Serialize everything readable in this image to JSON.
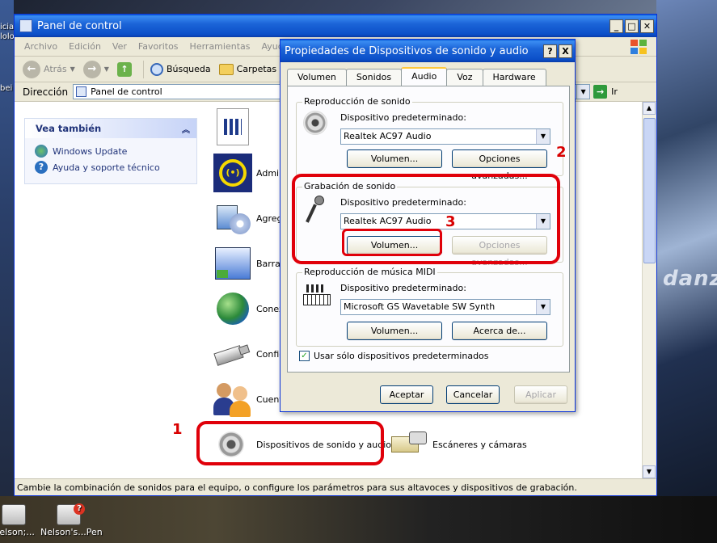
{
  "desktop": {
    "icons": [
      {
        "label": "Nelson;..."
      },
      {
        "label": "Nelson's...Pen"
      }
    ],
    "left_labels": [
      "icia",
      "lolo",
      "bei"
    ],
    "right_text": "danza"
  },
  "explorer": {
    "title": "Panel de control",
    "menu": [
      "Archivo",
      "Edición",
      "Ver",
      "Favoritos",
      "Herramientas",
      "Ayuda"
    ],
    "toolbar": {
      "back": "Atrás",
      "search": "Búsqueda",
      "folders": "Carpetas"
    },
    "address": {
      "label": "Dirección",
      "value": "Panel de control",
      "go": "Ir"
    },
    "see_also": {
      "title": "Vea también",
      "items": [
        "Windows Update",
        "Ayuda y soporte técnico"
      ]
    },
    "items": [
      {
        "label": "Admin"
      },
      {
        "label": "Agreg"
      },
      {
        "label": "Barra"
      },
      {
        "label": "Conex"
      },
      {
        "label": "Config"
      },
      {
        "label": "Cuent"
      },
      {
        "label": "Dispositivos de sonido y audio"
      },
      {
        "label": "Escáneres y cámaras"
      }
    ],
    "status": "Cambie la combinación de sonidos para el equipo, o configure los parámetros para sus altavoces y dispositivos de grabación."
  },
  "dialog": {
    "title": "Propiedades de Dispositivos de sonido y audio",
    "help_btn": "?",
    "close_btn": "X",
    "tabs": [
      "Volumen",
      "Sonidos",
      "Audio",
      "Voz",
      "Hardware"
    ],
    "active_tab": "Audio",
    "playback": {
      "legend": "Reproducción de sonido",
      "label": "Dispositivo predeterminado:",
      "device": "Realtek AC97 Audio",
      "volume_btn": "Volumen...",
      "advanced_btn": "Opciones avanzadas..."
    },
    "recording": {
      "legend": "Grabación de sonido",
      "label": "Dispositivo predeterminado:",
      "device": "Realtek AC97 Audio",
      "volume_btn": "Volumen...",
      "advanced_btn": "Opciones avanzadas..."
    },
    "midi": {
      "legend": "Reproducción de música MIDI",
      "label": "Dispositivo predeterminado:",
      "device": "Microsoft GS Wavetable SW Synth",
      "volume_btn": "Volumen...",
      "about_btn": "Acerca de..."
    },
    "checkbox_label": "Usar sólo dispositivos predeterminados",
    "ok": "Aceptar",
    "cancel": "Cancelar",
    "apply": "Aplicar"
  },
  "annotations": {
    "one": "1",
    "two": "2",
    "three": "3"
  },
  "colors": {
    "annotation": "#e0000a",
    "xp_title": "#0b4fc8"
  }
}
